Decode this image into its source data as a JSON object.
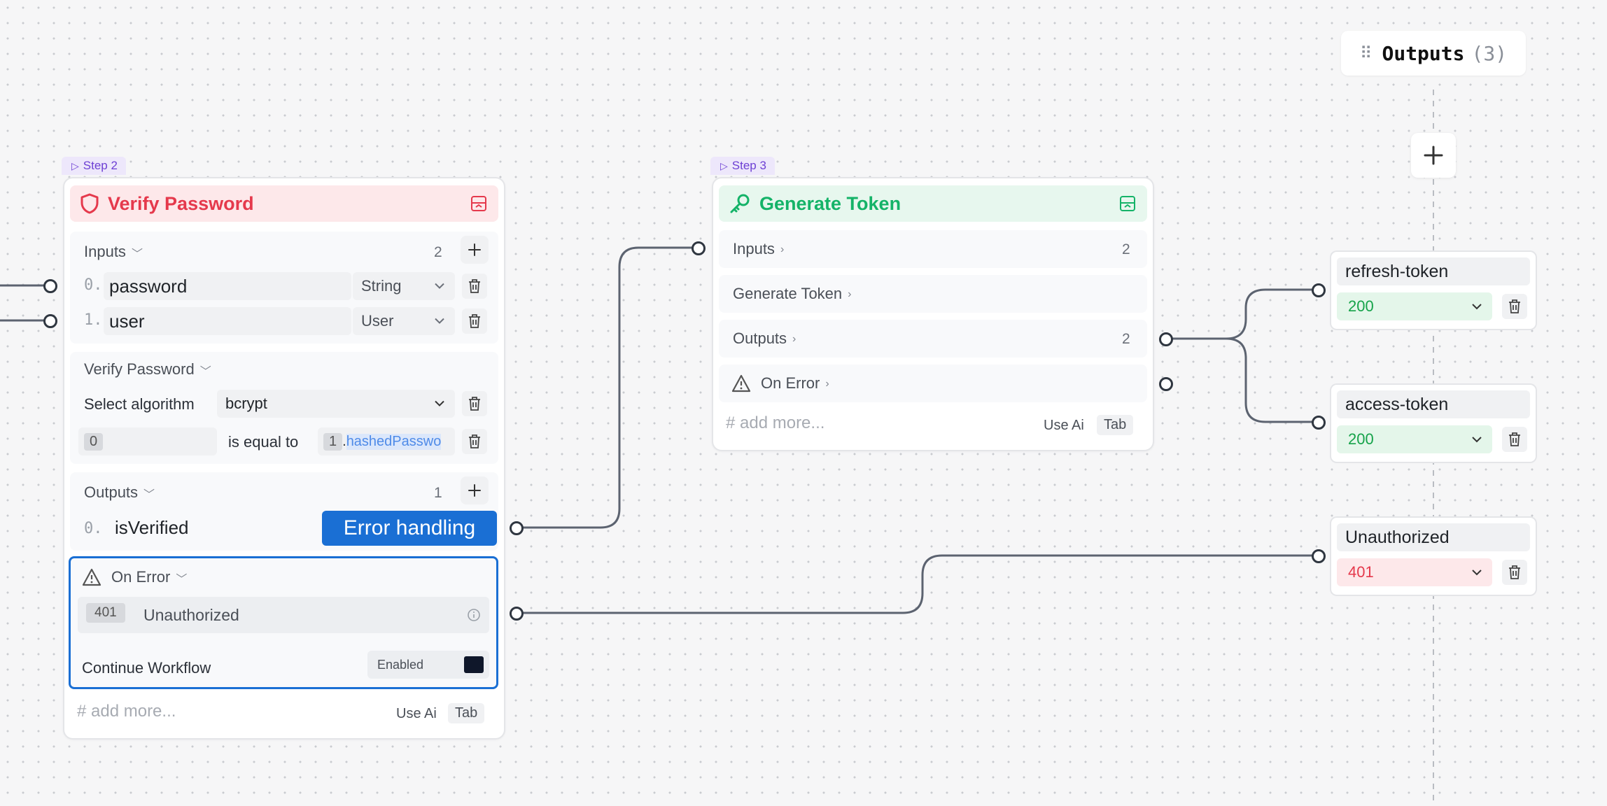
{
  "colors": {
    "verify_accent": "#e5394c",
    "verify_bg": "#fde8ea",
    "token_accent": "#14b368",
    "token_bg": "#e7f7ee",
    "selection_blue": "#1a6fd4",
    "step_tag_bg": "#ede7fb",
    "step_tag_text": "#6d3fd4",
    "wire": "#5c6370"
  },
  "outputs_panel": {
    "title": "Outputs",
    "count": "(3)"
  },
  "step2": {
    "tag": "Step 2",
    "title": "Verify Password",
    "icon": "shield-icon",
    "inputs": {
      "label": "Inputs",
      "count": "2",
      "rows": [
        {
          "index": "0.",
          "name": "password",
          "type": "String"
        },
        {
          "index": "1.",
          "name": "user",
          "type": "User"
        }
      ]
    },
    "verify": {
      "label": "Verify Password",
      "algorithm_label": "Select algorithm",
      "algorithm_value": "bcrypt",
      "lhs_ref": "0",
      "operator": "is equal to",
      "rhs_ref": "1",
      "rhs_dot": ".",
      "rhs_prop": "hashedPasswo"
    },
    "outputs": {
      "label": "Outputs",
      "count": "1",
      "rows": [
        {
          "index": "0.",
          "name": "isVerified"
        }
      ]
    },
    "tooltip": "Error handling",
    "on_error": {
      "label": "On Error",
      "code": "401",
      "message": "Unauthorized",
      "continue_label": "Continue Workflow",
      "continue_value": "Enabled"
    },
    "add_more": "# add more...",
    "use_ai": "Use Ai",
    "tab": "Tab"
  },
  "step3": {
    "tag": "Step 3",
    "title": "Generate Token",
    "icon": "key-icon",
    "inputs_label": "Inputs",
    "inputs_count": "2",
    "generate_label": "Generate Token",
    "outputs_label": "Outputs",
    "outputs_count": "2",
    "on_error_label": "On Error",
    "add_more": "# add more...",
    "use_ai": "Use Ai",
    "tab": "Tab"
  },
  "response_outputs": [
    {
      "name": "refresh-token",
      "code": "200",
      "status": "success"
    },
    {
      "name": "access-token",
      "code": "200",
      "status": "success"
    },
    {
      "name": "Unauthorized",
      "code": "401",
      "status": "error"
    }
  ]
}
